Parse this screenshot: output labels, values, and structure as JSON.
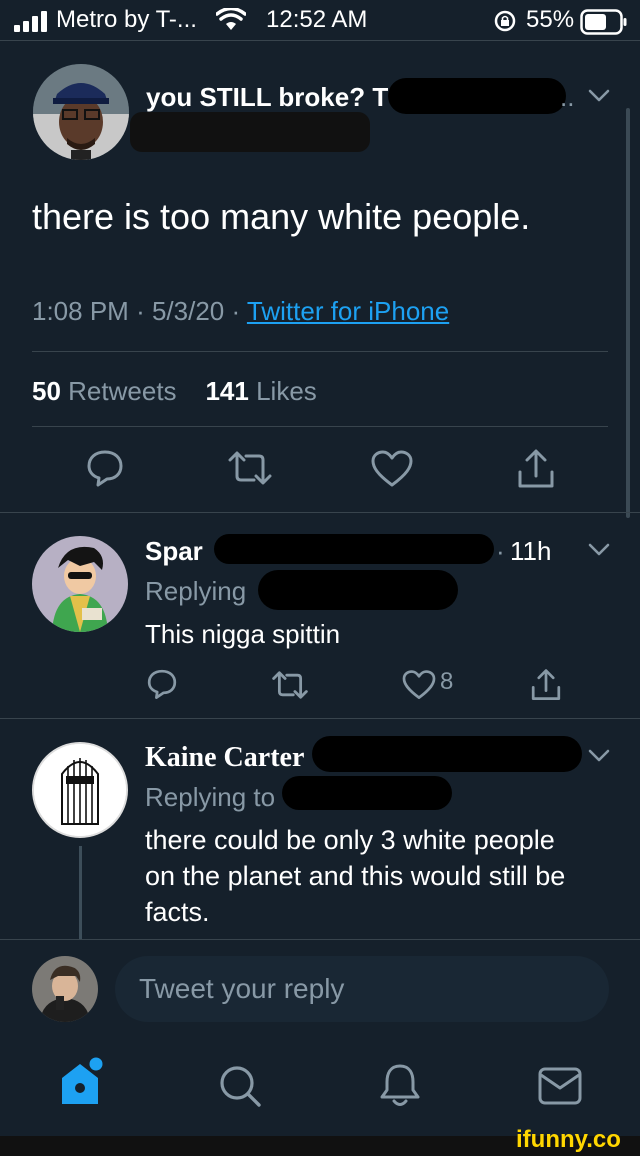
{
  "status_bar": {
    "carrier": "Metro by T-...",
    "time": "12:52 AM",
    "battery": "55%"
  },
  "main_tweet": {
    "author_display": "you STILL broke? T",
    "text": "there is too many white people.",
    "time": "1:08 PM",
    "date": "5/3/20",
    "source": "Twitter for iPhone",
    "retweets_count": "50",
    "retweets_label": "Retweets",
    "likes_count": "141",
    "likes_label": "Likes"
  },
  "replies": [
    {
      "name": "Spar",
      "age": "11h",
      "replying": "Replying",
      "text": "This nigga spittin",
      "like_count": "8"
    },
    {
      "name": "Kaine Carter",
      "replying": "Replying to",
      "text_lines": [
        "there could be only 3 white people",
        "on the planet and this would still be",
        "facts."
      ]
    }
  ],
  "composer": {
    "placeholder": "Tweet your reply"
  },
  "watermark": "ifunny.co",
  "colors": {
    "background": "#15202b",
    "accent": "#1da1f2",
    "muted": "#8899a6",
    "divider": "#38444d"
  }
}
